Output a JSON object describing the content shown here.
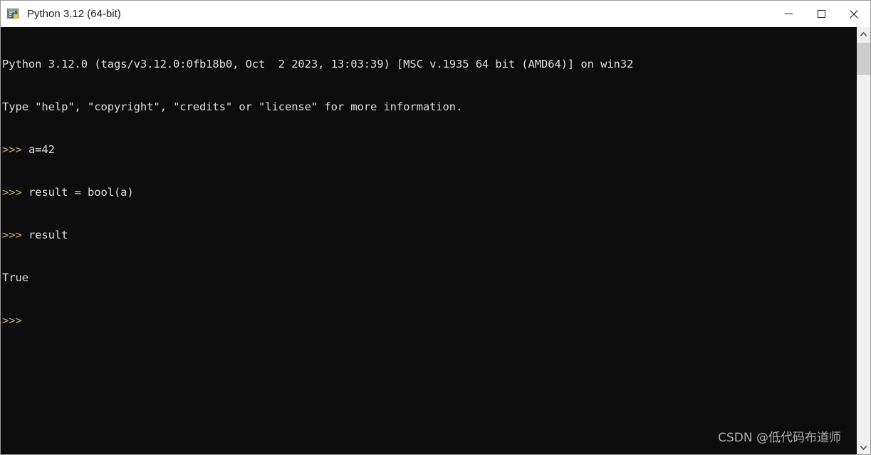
{
  "window": {
    "title": "Python 3.12 (64-bit)",
    "icon": "python-console-icon",
    "controls": {
      "minimize_label": "Minimize",
      "maximize_label": "Maximize",
      "close_label": "Close"
    }
  },
  "console": {
    "background_color": "#0d0d0d",
    "text_color": "#d6d6d6",
    "prompt_color": "#c2ad81",
    "lines": [
      {
        "kind": "output",
        "text": "Python 3.12.0 (tags/v3.12.0:0fb18b0, Oct  2 2023, 13:03:39) [MSC v.1935 64 bit (AMD64)] on win32"
      },
      {
        "kind": "output",
        "text": "Type \"help\", \"copyright\", \"credits\" or \"license\" for more information."
      },
      {
        "kind": "input",
        "prompt": ">>> ",
        "text": "a=42"
      },
      {
        "kind": "input",
        "prompt": ">>> ",
        "text": "result = bool(a)"
      },
      {
        "kind": "input",
        "prompt": ">>> ",
        "text": "result"
      },
      {
        "kind": "output",
        "text": "True"
      },
      {
        "kind": "input",
        "prompt": ">>>",
        "text": ""
      }
    ]
  },
  "watermark": {
    "text": "CSDN @低代码布道师"
  },
  "scrollbar": {
    "up_arrow": "chevron-up-icon",
    "down_arrow": "chevron-down-icon",
    "thumb_position_percent": 0,
    "thumb_size_px": 45
  }
}
